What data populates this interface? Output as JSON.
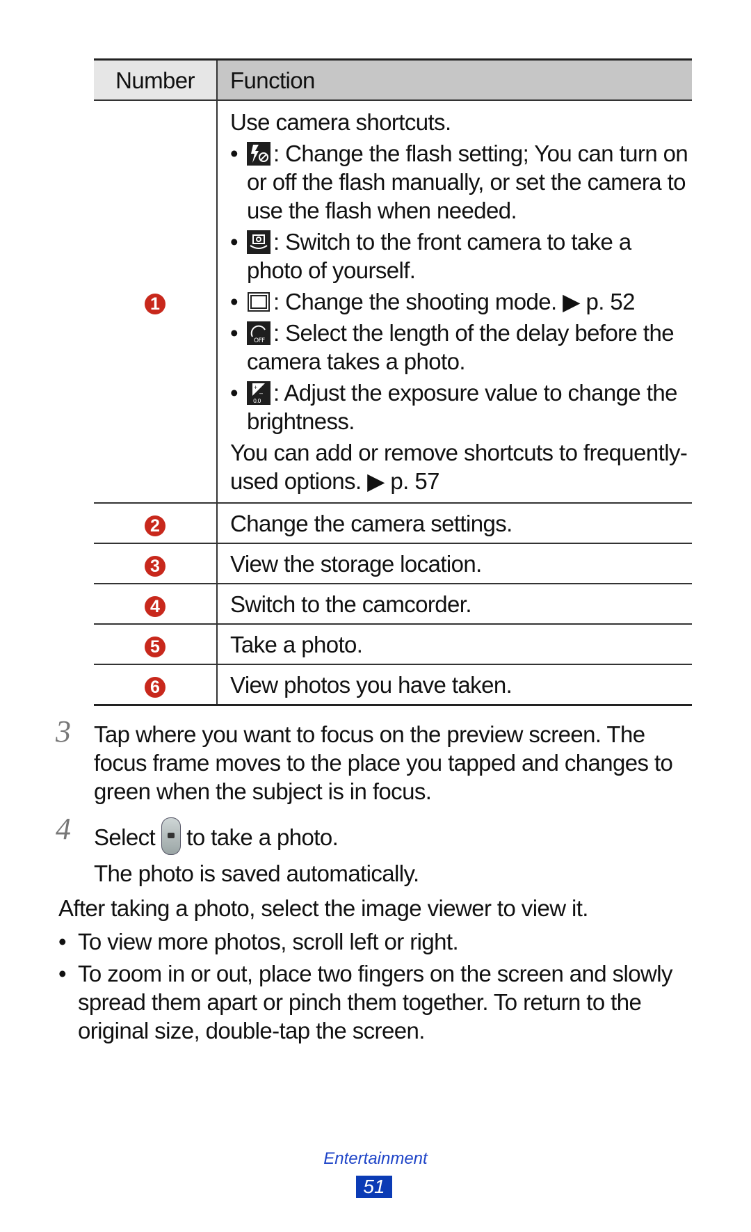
{
  "table": {
    "headers": {
      "number": "Number",
      "function": "Function"
    },
    "row1": {
      "number": "1",
      "intro": "Use camera shortcuts.",
      "bullets": [
        {
          "icon": "flash-off-icon",
          "text": ": Change the flash setting; You can turn on or off the flash manually, or set the camera to use the flash when needed."
        },
        {
          "icon": "switch-camera-icon",
          "text": ": Switch to the front camera to take a photo of yourself."
        },
        {
          "icon": "shooting-mode-icon",
          "text": ": Change the shooting mode. ▶ p. 52"
        },
        {
          "icon": "timer-off-icon",
          "text": ": Select the length of the delay before the camera takes a photo."
        },
        {
          "icon": "exposure-icon",
          "text": ": Adjust the exposure value to change the brightness."
        }
      ],
      "outro": "You can add or remove shortcuts to frequently-used options. ▶ p. 57",
      "exposure_label": "0.0"
    },
    "rows": [
      {
        "number": "2",
        "function": "Change the camera settings."
      },
      {
        "number": "3",
        "function": "View the storage location."
      },
      {
        "number": "4",
        "function": "Switch to the camcorder."
      },
      {
        "number": "5",
        "function": "Take a photo."
      },
      {
        "number": "6",
        "function": "View photos you have taken."
      }
    ]
  },
  "steps": [
    {
      "number": "3",
      "text": "Tap where you want to focus on the preview screen. The focus frame moves to the place you tapped and changes to green when the subject is in focus."
    },
    {
      "number": "4",
      "before": "Select",
      "after": "to take a photo.",
      "line2": "The photo is saved automatically."
    }
  ],
  "after_text": "After taking a photo, select the image viewer to view it.",
  "tips": [
    "To view more photos, scroll left or right.",
    "To zoom in or out, place two fingers on the screen and slowly spread them apart or pinch them together. To return to the original size, double-tap the screen."
  ],
  "footer": {
    "section": "Entertainment",
    "page": "51"
  },
  "colors": {
    "badge": "#c8281c",
    "footer_blue": "#1f45c8",
    "page_box": "#0b3bb5",
    "header_number_bg": "#e6e6e6",
    "header_function_bg": "#c6c6c6"
  }
}
